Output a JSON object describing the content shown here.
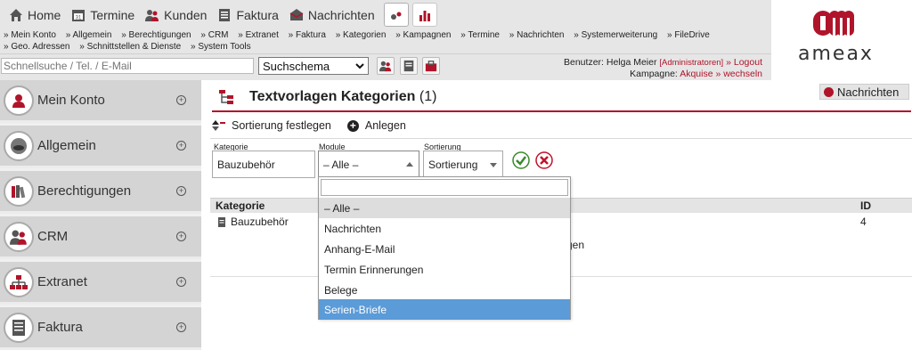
{
  "nav": {
    "items": [
      {
        "label": "Home",
        "icon": "home-icon"
      },
      {
        "label": "Termine",
        "icon": "calendar-icon"
      },
      {
        "label": "Kunden",
        "icon": "users-icon"
      },
      {
        "label": "Faktura",
        "icon": "document-icon"
      },
      {
        "label": "Nachrichten",
        "icon": "mail-icon"
      }
    ]
  },
  "breadcrumbs": [
    "» Mein Konto",
    "» Allgemein",
    "» Berechtigungen",
    "» CRM",
    "» Extranet",
    "» Faktura",
    "» Kategorien",
    "» Kampagnen",
    "» Termine",
    "» Nachrichten",
    "» Systemerweiterung",
    "» FileDrive",
    "» Geo. Adressen",
    "» Schnittstellen & Dienste",
    "» System Tools"
  ],
  "search": {
    "placeholder": "Schnellsuche / Tel. / E-Mail",
    "schema_value": "Suchschema"
  },
  "user": {
    "prefix": "Benutzer: Helga Meier",
    "role": "[Administratoren]",
    "logout": "» Logout",
    "campaign_prefix": "Kampagne:",
    "campaign": "Akquise",
    "switch": "» wechseln"
  },
  "logo": {
    "text": "ameax",
    "color": "#b0142a"
  },
  "sidebar": {
    "items": [
      {
        "label": "Mein Konto",
        "icon": "user-icon"
      },
      {
        "label": "Allgemein",
        "icon": "general-icon"
      },
      {
        "label": "Berechtigungen",
        "icon": "binders-icon"
      },
      {
        "label": "CRM",
        "icon": "users-icon"
      },
      {
        "label": "Extranet",
        "icon": "network-icon"
      },
      {
        "label": "Faktura",
        "icon": "invoice-icon"
      }
    ]
  },
  "page": {
    "title": "Textvorlagen Kategorien",
    "count": "(1)",
    "messages_button": "Nachrichten"
  },
  "toolbar": {
    "sort_label": "Sortierung festlegen",
    "add_label": "Anlegen"
  },
  "filters": {
    "kategorie_label": "Kategorie",
    "kategorie_value": "Bauzubehör",
    "module_label": "Module",
    "module_value": "– Alle –",
    "sortierung_label": "Sortierung",
    "sortierung_value": "Sortierung"
  },
  "table": {
    "headers": [
      "Kategorie",
      "ID"
    ],
    "rows": [
      {
        "kategorie": "Bauzubehör",
        "module_partial": "gen",
        "id": "4"
      }
    ]
  },
  "dropdown": {
    "options": [
      "– Alle –",
      "Nachrichten",
      "Anhang-E-Mail",
      "Termin Erinnerungen",
      "Belege",
      "Serien-Briefe"
    ],
    "selected_index": 0,
    "highlighted_index": 5
  },
  "colors": {
    "accent": "#b0142a",
    "highlight": "#5b9bd8",
    "nav_bg": "#e6e6e6",
    "sidebar_bg": "#d4d4d4"
  }
}
